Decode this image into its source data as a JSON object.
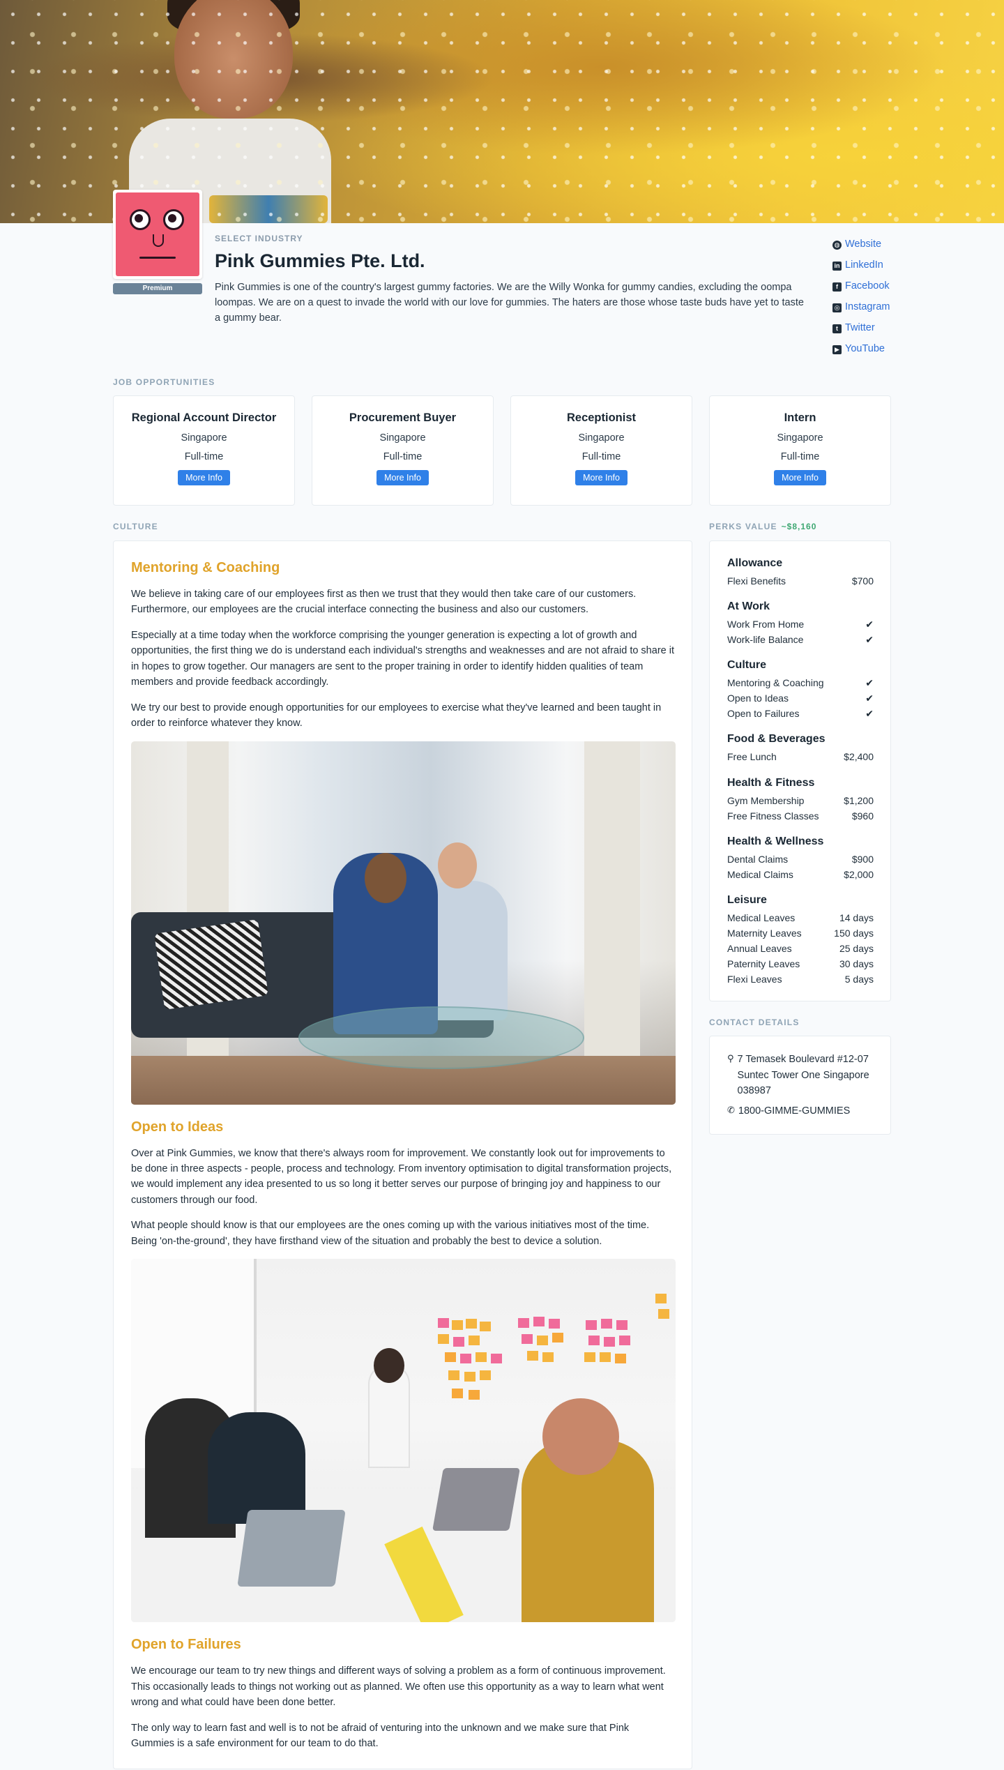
{
  "company": {
    "industry": "SELECT INDUSTRY",
    "name": "Pink Gummies Pte. Ltd.",
    "badge": "Premium",
    "description": "Pink Gummies is one of the country's largest gummy factories. We are the Willy Wonka for gummy candies, excluding the oompa loompas. We are on a quest to invade the world with our love for gummies. The haters are those whose taste buds have yet to taste a gummy bear."
  },
  "socials": [
    {
      "label": "Website",
      "icon": "globe-icon"
    },
    {
      "label": "LinkedIn",
      "icon": "linkedin-icon"
    },
    {
      "label": "Facebook",
      "icon": "facebook-icon"
    },
    {
      "label": "Instagram",
      "icon": "instagram-icon"
    },
    {
      "label": "Twitter",
      "icon": "twitter-icon"
    },
    {
      "label": "YouTube",
      "icon": "youtube-icon"
    }
  ],
  "jobs": {
    "label": "JOB OPPORTUNITIES",
    "button_label": "More Info",
    "items": [
      {
        "title": "Regional Account Director",
        "location": "Singapore",
        "type": "Full-time"
      },
      {
        "title": "Procurement Buyer",
        "location": "Singapore",
        "type": "Full-time"
      },
      {
        "title": "Receptionist",
        "location": "Singapore",
        "type": "Full-time"
      },
      {
        "title": "Intern",
        "location": "Singapore",
        "type": "Full-time"
      }
    ]
  },
  "culture": {
    "label": "CULTURE",
    "sections": [
      {
        "heading": "Mentoring & Coaching",
        "paragraphs": [
          "We believe in taking care of our employees first as then we trust that they would then take care of our customers. Furthermore, our employees are the crucial interface connecting the business and also our customers.",
          "Especially at a time today when the workforce comprising the younger generation is expecting a lot of growth and opportunities, the first thing we do is understand each individual's strengths and weaknesses and are not afraid to share it in hopes to grow together. Our managers are sent to the proper training in order to identify hidden qualities of team members and provide feedback accordingly.",
          "We try our best to provide enough opportunities for our employees to exercise what they've learned and been taught in order to reinforce whatever they know."
        ]
      },
      {
        "heading": "Open to Ideas",
        "paragraphs": [
          "Over at Pink Gummies, we know that there's always room for improvement. We constantly look out for improvements to be done in three aspects - people, process and technology. From inventory optimisation to digital transformation projects, we would implement any idea presented to us so long it better serves our purpose of bringing joy and happiness to our customers through our food.",
          "What people should know is that our employees are the ones coming up with the various initiatives most of the time. Being 'on-the-ground', they have firsthand view of the situation and probably the best to device a solution."
        ]
      },
      {
        "heading": "Open to Failures",
        "paragraphs": [
          "We encourage our team to try new things and different ways of solving a problem as a form of continuous improvement. This occasionally leads to things not working out as planned. We often use this opportunity as a way to learn what went wrong and what could have been done better.",
          "The only way to learn fast and well is to not be afraid of venturing into the unknown and we make sure that Pink Gummies is a safe environment for our team to do that."
        ]
      }
    ]
  },
  "perks": {
    "label": "PERKS VALUE",
    "value": "~$8,160",
    "groups": [
      {
        "title": "Allowance",
        "items": [
          {
            "name": "Flexi Benefits",
            "value": "$700"
          }
        ]
      },
      {
        "title": "At Work",
        "items": [
          {
            "name": "Work From Home",
            "value": "✔"
          },
          {
            "name": "Work-life Balance",
            "value": "✔"
          }
        ]
      },
      {
        "title": "Culture",
        "items": [
          {
            "name": "Mentoring & Coaching",
            "value": "✔"
          },
          {
            "name": "Open to Ideas",
            "value": "✔"
          },
          {
            "name": "Open to Failures",
            "value": "✔"
          }
        ]
      },
      {
        "title": "Food & Beverages",
        "items": [
          {
            "name": "Free Lunch",
            "value": "$2,400"
          }
        ]
      },
      {
        "title": "Health & Fitness",
        "items": [
          {
            "name": "Gym Membership",
            "value": "$1,200"
          },
          {
            "name": "Free Fitness Classes",
            "value": "$960"
          }
        ]
      },
      {
        "title": "Health & Wellness",
        "items": [
          {
            "name": "Dental Claims",
            "value": "$900"
          },
          {
            "name": "Medical Claims",
            "value": "$2,000"
          }
        ]
      },
      {
        "title": "Leisure",
        "items": [
          {
            "name": "Medical Leaves",
            "value": "14 days"
          },
          {
            "name": "Maternity Leaves",
            "value": "150 days"
          },
          {
            "name": "Annual Leaves",
            "value": "25 days"
          },
          {
            "name": "Paternity Leaves",
            "value": "30 days"
          },
          {
            "name": "Flexi Leaves",
            "value": "5 days"
          }
        ]
      }
    ]
  },
  "contact": {
    "label": "CONTACT DETAILS",
    "address": "7 Temasek Boulevard #12-07 Suntec Tower One Singapore 038987",
    "phone": "1800-GIMME-GUMMIES"
  }
}
